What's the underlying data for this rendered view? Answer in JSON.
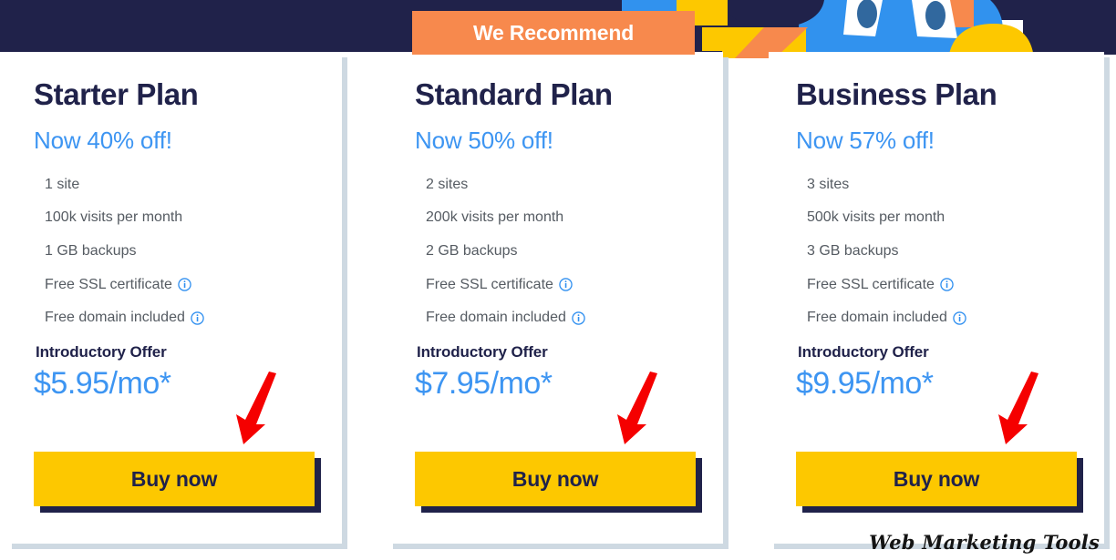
{
  "ribbon": {
    "label": "We Recommend",
    "color": "#f7894d"
  },
  "colors": {
    "navy": "#20224a",
    "blue": "#3d95f2",
    "yellow": "#fdc800",
    "orange": "#f7894d",
    "arrow_red": "#f50000",
    "card_shadow": "#ced9e2",
    "feature_text": "#555b62"
  },
  "plans": [
    {
      "title": "Starter Plan",
      "discount": "Now 40% off!",
      "features": [
        {
          "text": "1 site",
          "info": false
        },
        {
          "text": "100k visits per month",
          "info": false
        },
        {
          "text": "1 GB backups",
          "info": false
        },
        {
          "text": "Free SSL certificate",
          "info": true
        },
        {
          "text": "Free domain included",
          "info": true
        }
      ],
      "offer_label": "Introductory Offer",
      "price": "$5.95/mo*",
      "cta": "Buy now"
    },
    {
      "title": "Standard Plan",
      "discount": "Now 50% off!",
      "features": [
        {
          "text": "2 sites",
          "info": false
        },
        {
          "text": "200k visits per month",
          "info": false
        },
        {
          "text": "2 GB backups",
          "info": false
        },
        {
          "text": "Free SSL certificate",
          "info": true
        },
        {
          "text": "Free domain included",
          "info": true
        }
      ],
      "offer_label": "Introductory Offer",
      "price": "$7.95/mo*",
      "cta": "Buy now"
    },
    {
      "title": "Business Plan",
      "discount": "Now 57% off!",
      "features": [
        {
          "text": "3 sites",
          "info": false
        },
        {
          "text": "500k visits per month",
          "info": false
        },
        {
          "text": "3 GB backups",
          "info": false
        },
        {
          "text": "Free SSL certificate",
          "info": true
        },
        {
          "text": "Free domain included",
          "info": true
        }
      ],
      "offer_label": "Introductory Offer",
      "price": "$9.95/mo*",
      "cta": "Buy now"
    }
  ],
  "annotations": {
    "arrow_count": 3,
    "arrow_icon": "red-down-left-arrow-icon"
  },
  "watermark": {
    "text": "Web Marketing Tools"
  }
}
